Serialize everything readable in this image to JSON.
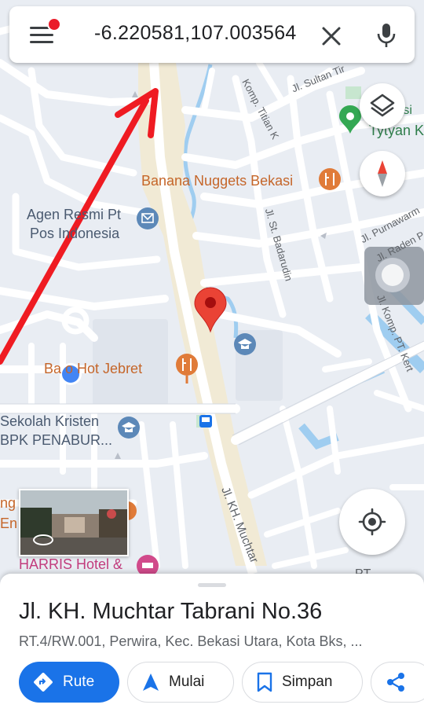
{
  "search": {
    "query": "-6.220581,107.003564"
  },
  "map": {
    "places": {
      "banana_nuggets": "Banana Nuggets Bekasi",
      "agen_line1": "Agen Resmi Pt",
      "agen_line2": "Pos Indonesia",
      "hot_jebret": "Ba   o Hot Jebret",
      "sekolah_line1": "Sekolah Kristen",
      "sekolah_line2": "BPK PENABUR...",
      "harris": "HARRIS Hotel &",
      "tytyan": "Tytyan K",
      "utsi": "utsi",
      "left_edge_1": "ng",
      "left_edge_2": "En",
      "pt_right": "PT"
    },
    "streets": {
      "sultan": "Jl. Sultan Tir",
      "titian": "Komp. Titian K",
      "st_badarudin": "Jl. St. Badarudin",
      "purnawarm": "Jl. Purnawarm",
      "raden": "Jl. Raden P",
      "kert": "Jl. Komp. PT. Kert",
      "kh_muchtar": "Jl. KH. Muchtar"
    },
    "colors": {
      "land": "#e9edf3",
      "road": "#ffffff",
      "road_outline": "#d3d8e0",
      "water": "#9fcdf0",
      "park": "#c7e6cf",
      "highway_fill": "#f1ead5",
      "pin_red": "#ea4335",
      "user_blue": "#4285f4",
      "arrow_red": "#ef1b22",
      "food_orange": "#e07b39",
      "edu_blue": "#5c88b8",
      "hotel_pink": "#d14a8b",
      "accent": "#1a73e8"
    }
  },
  "place": {
    "title": "Jl. KH. Muchtar Tabrani No.36",
    "address": "RT.4/RW.001, Perwira, Kec. Bekasi Utara, Kota Bks, ..."
  },
  "actions": {
    "route_label": "Rute",
    "start_label": "Mulai",
    "save_label": "Simpan"
  },
  "icons": {
    "menu": "menu-icon",
    "close": "close-icon",
    "mic": "mic-icon",
    "layers": "layers-icon",
    "compass": "compass-icon",
    "my_location": "my-location-icon",
    "directions": "directions-icon",
    "navigation": "navigation-arrow-icon",
    "bookmark": "bookmark-icon",
    "share": "share-icon"
  }
}
